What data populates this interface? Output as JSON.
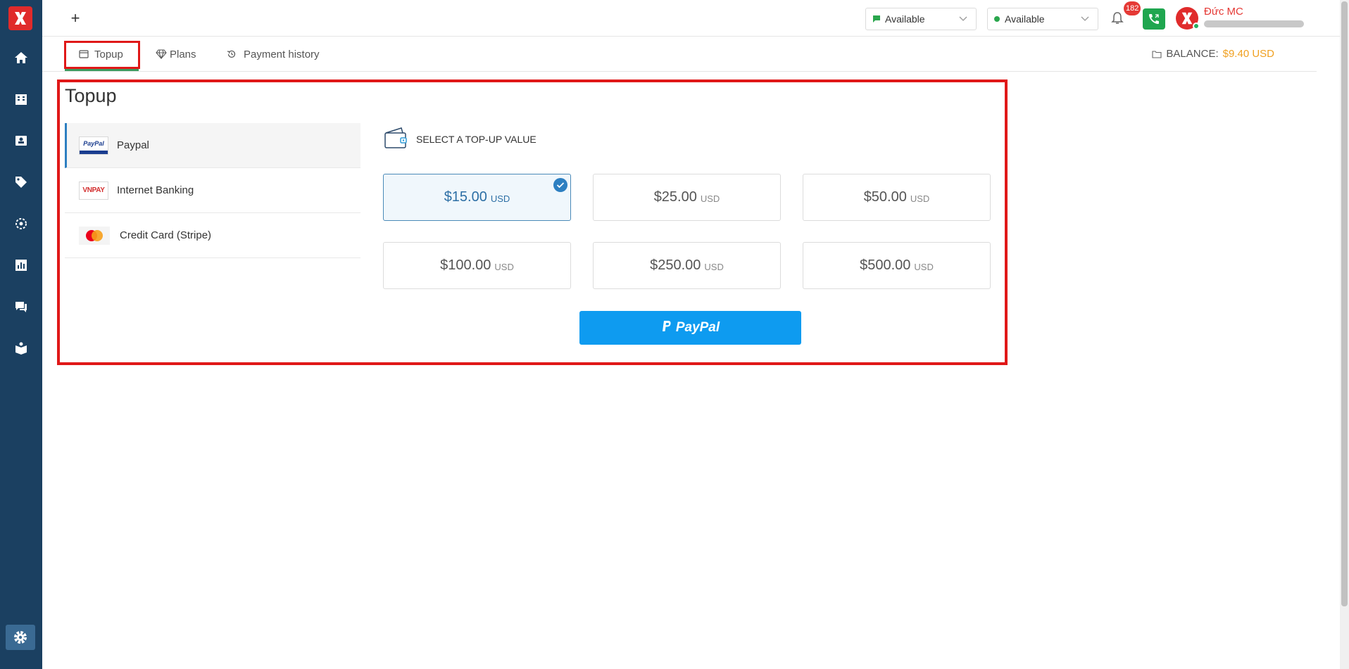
{
  "sidebar": {
    "items": [
      "home-icon",
      "building-icon",
      "contact-icon",
      "tag-icon",
      "target-icon",
      "report-icon",
      "chat-icon",
      "book-icon",
      "gear-icon"
    ],
    "accent": "#1b4061"
  },
  "topbar": {
    "add_label": "+",
    "chat_status": "Available",
    "call_status": "Available",
    "notification_count": "182",
    "user_name": "Đức MC"
  },
  "tabs": {
    "topup": "Topup",
    "plans": "Plans",
    "history": "Payment history",
    "balance_label": "BALANCE:",
    "balance_value": "$9.40 USD"
  },
  "main": {
    "title": "Topup",
    "methods": [
      {
        "logo": "PayPal",
        "label": "Paypal"
      },
      {
        "logo": "VNPAY",
        "label": "Internet Banking"
      },
      {
        "logo": "MasterCard",
        "label": "Credit Card (Stripe)"
      }
    ],
    "select_heading": "SELECT A TOP-UP VALUE",
    "amounts": [
      {
        "value": "$15.00",
        "currency": "USD"
      },
      {
        "value": "$25.00",
        "currency": "USD"
      },
      {
        "value": "$50.00",
        "currency": "USD"
      },
      {
        "value": "$100.00",
        "currency": "USD"
      },
      {
        "value": "$250.00",
        "currency": "USD"
      },
      {
        "value": "$500.00",
        "currency": "USD"
      }
    ],
    "paypal_button": "PayPal"
  },
  "colors": {
    "highlight": "#e01818",
    "paypal_blue": "#0e9bf0",
    "balance": "#f0a020"
  }
}
